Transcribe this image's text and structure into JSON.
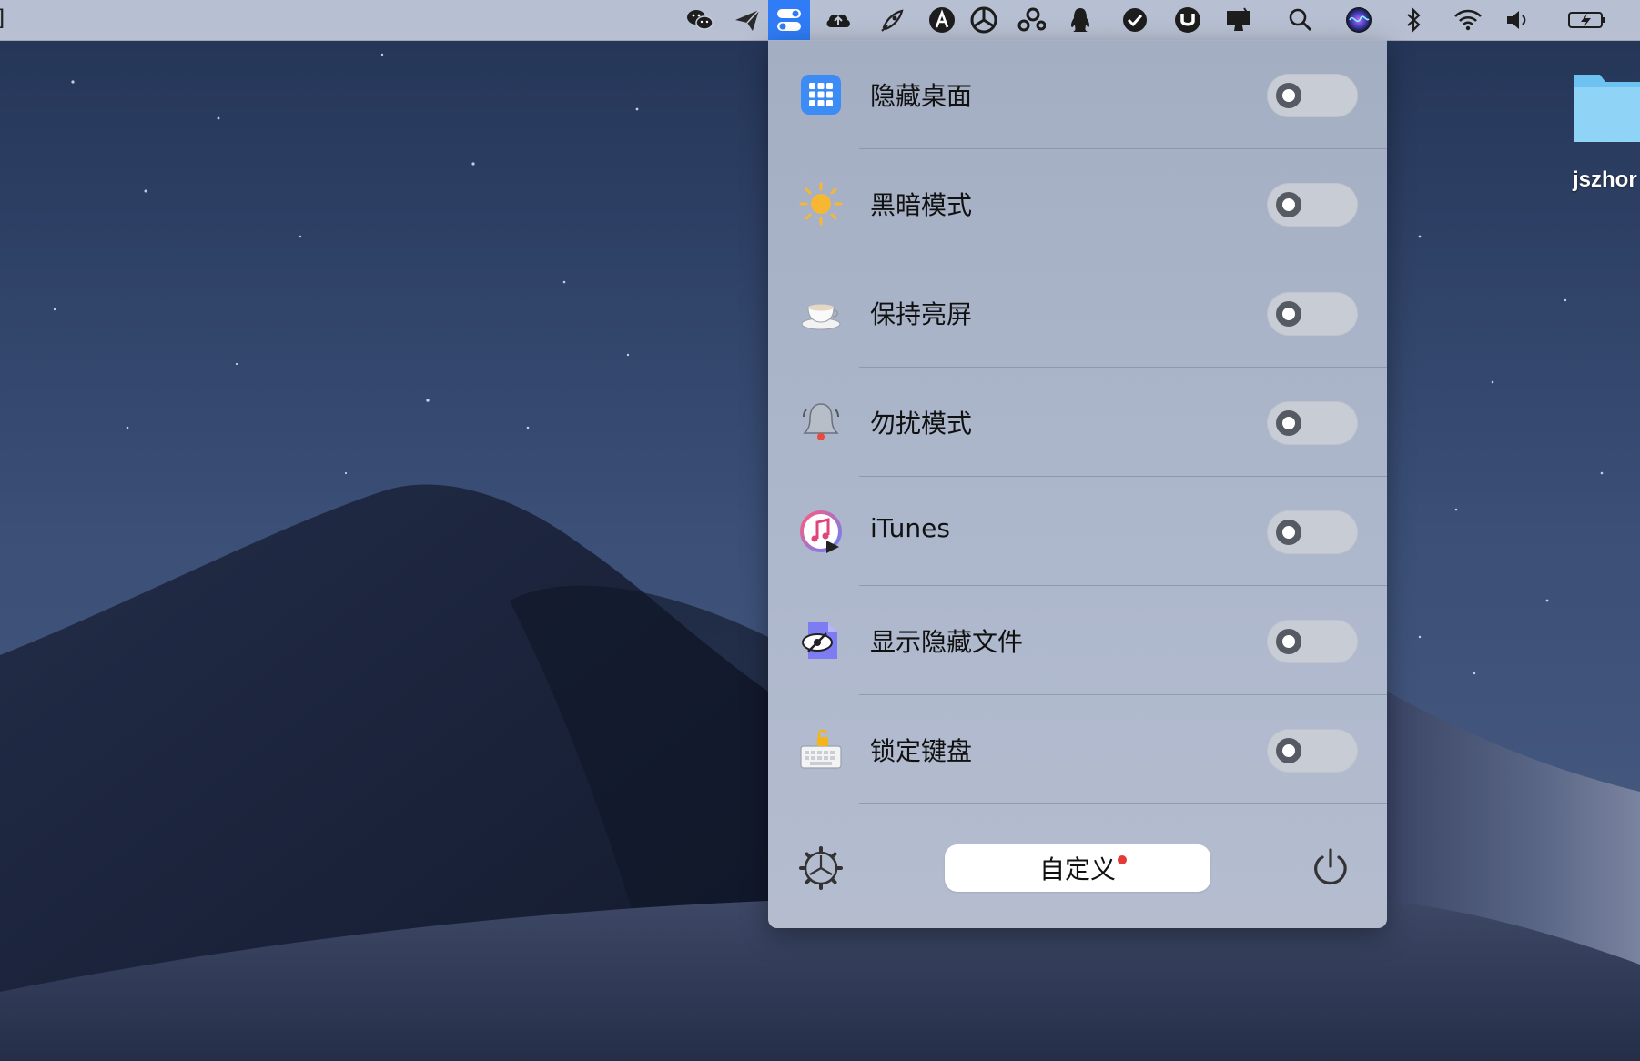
{
  "menubar": {
    "left_glyph": "]",
    "icons": [
      {
        "name": "wechat-icon"
      },
      {
        "name": "send-icon"
      },
      {
        "name": "toggles-icon",
        "active": true
      },
      {
        "name": "cloud-upload-icon"
      },
      {
        "name": "satellite-icon"
      },
      {
        "name": "app-a-icon"
      },
      {
        "name": "yinyang-icon"
      },
      {
        "name": "linked-circles-icon"
      },
      {
        "name": "qq-penguin-icon"
      },
      {
        "name": "checkmark-badge-icon"
      },
      {
        "name": "u-shield-icon"
      },
      {
        "name": "display-icon"
      },
      {
        "name": "search-icon"
      },
      {
        "name": "siri-icon"
      },
      {
        "name": "bluetooth-icon"
      },
      {
        "name": "wifi-icon"
      },
      {
        "name": "volume-icon"
      },
      {
        "name": "battery-charging-icon"
      }
    ],
    "accent": "#2f7cf6"
  },
  "desktop": {
    "folder_label": "jszhor"
  },
  "panel": {
    "items": [
      {
        "label": "隐藏桌面",
        "icon": "grid-icon",
        "enabled": false
      },
      {
        "label": "黑暗模式",
        "icon": "sun-icon",
        "enabled": false
      },
      {
        "label": "保持亮屏",
        "icon": "coffee-cup-icon",
        "enabled": false
      },
      {
        "label": "勿扰模式",
        "icon": "bell-icon",
        "enabled": false
      },
      {
        "label": "iTunes",
        "icon": "itunes-icon",
        "enabled": false
      },
      {
        "label": "显示隐藏文件",
        "icon": "hidden-eye-icon",
        "enabled": false
      },
      {
        "label": "锁定键盘",
        "icon": "keyboard-lock-icon",
        "enabled": false
      }
    ],
    "footer": {
      "customize_label": "自定义",
      "settings_icon": "gear-icon",
      "power_icon": "power-icon",
      "badge_color": "#e53935"
    }
  }
}
